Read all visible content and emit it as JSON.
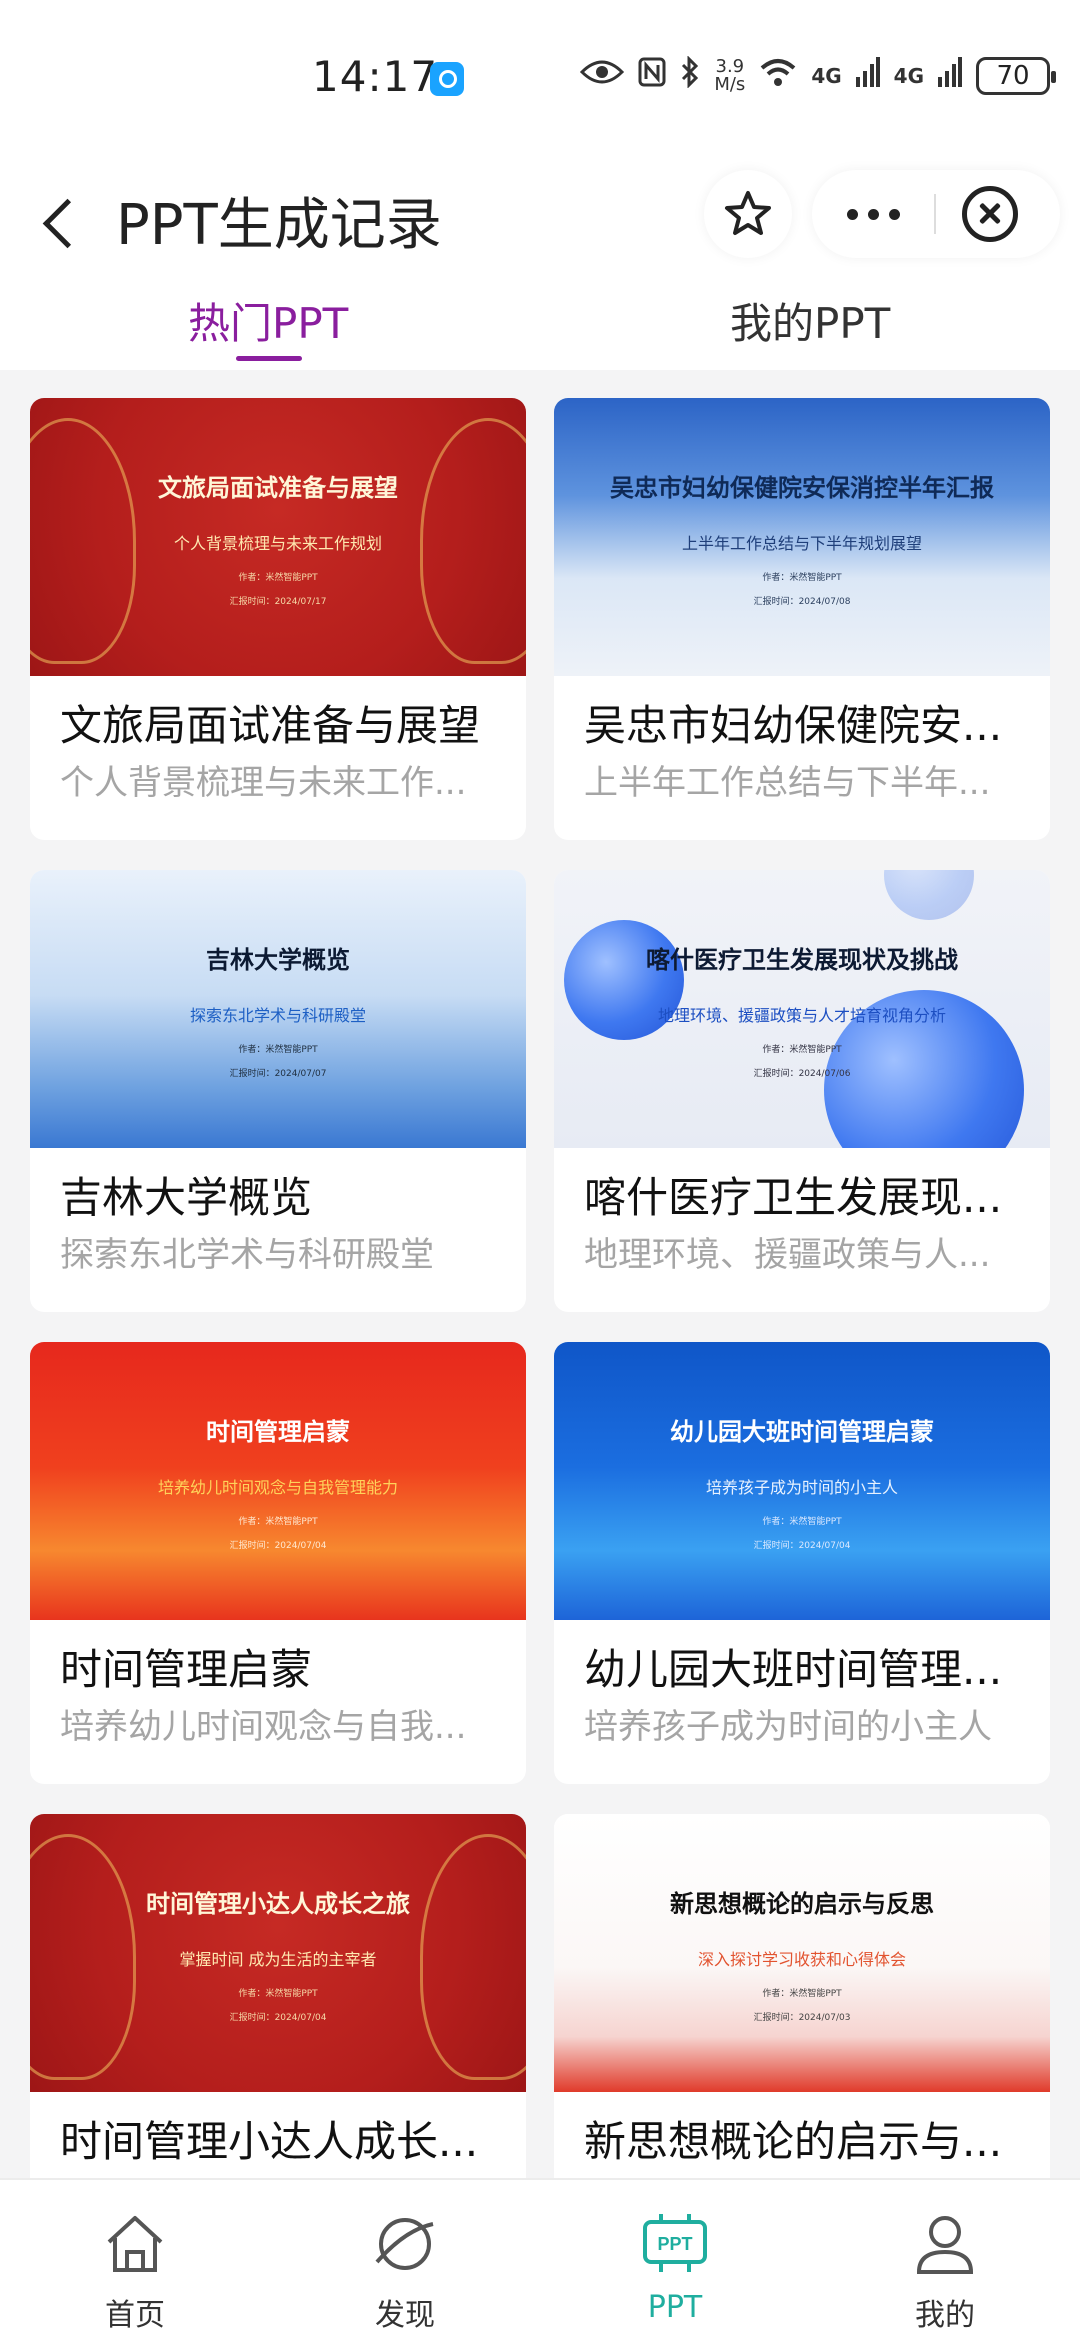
{
  "status_bar": {
    "time": "14:17",
    "speed_value": "3.9",
    "speed_unit": "M/s",
    "net1": "4G",
    "net2": "4G",
    "battery": "70"
  },
  "header": {
    "title": "PPT生成记录",
    "tabs": [
      {
        "label": "热门PPT",
        "active": true
      },
      {
        "label": "我的PPT",
        "active": false
      }
    ]
  },
  "cards": [
    {
      "title": "文旅局面试准备与展望",
      "subtitle": "个人背景梳理与未来工作...",
      "thumb": {
        "title": "文旅局面试准备与展望",
        "subtitle": "个人背景梳理与未来工作规划",
        "author": "作者：米然智能PPT",
        "date": "汇报时间：2024/07/17"
      }
    },
    {
      "title": "吴忠市妇幼保健院安...",
      "subtitle": "上半年工作总结与下半年...",
      "thumb": {
        "title": "吴忠市妇幼保健院安保消控半年汇报",
        "subtitle": "上半年工作总结与下半年规划展望",
        "author": "作者：米然智能PPT",
        "date": "汇报时间：2024/07/08"
      }
    },
    {
      "title": "吉林大学概览",
      "subtitle": "探索东北学术与科研殿堂",
      "thumb": {
        "title": "吉林大学概览",
        "subtitle": "探索东北学术与科研殿堂",
        "author": "作者：米然智能PPT",
        "date": "汇报时间：2024/07/07"
      }
    },
    {
      "title": "喀什医疗卫生发展现...",
      "subtitle": "地理环境、援疆政策与人...",
      "thumb": {
        "title": "喀什医疗卫生发展现状及挑战",
        "subtitle": "地理环境、援疆政策与人才培育视角分析",
        "author": "作者：米然智能PPT",
        "date": "汇报时间：2024/07/06"
      }
    },
    {
      "title": "时间管理启蒙",
      "subtitle": "培养幼儿时间观念与自我...",
      "thumb": {
        "title": "时间管理启蒙",
        "subtitle": "培养幼儿时间观念与自我管理能力",
        "author": "作者：米然智能PPT",
        "date": "汇报时间：2024/07/04"
      }
    },
    {
      "title": "幼儿园大班时间管理...",
      "subtitle": "培养孩子成为时间的小主人",
      "thumb": {
        "title": "幼儿园大班时间管理启蒙",
        "subtitle": "培养孩子成为时间的小主人",
        "author": "作者：米然智能PPT",
        "date": "汇报时间：2024/07/04"
      }
    },
    {
      "title": "时间管理小达人成长...",
      "subtitle": "",
      "thumb": {
        "title": "时间管理小达人成长之旅",
        "subtitle": "掌握时间 成为生活的主宰者",
        "author": "作者：米然智能PPT",
        "date": "汇报时间：2024/07/04"
      }
    },
    {
      "title": "新思想概论的启示与...",
      "subtitle": "",
      "thumb": {
        "title": "新思想概论的启示与反思",
        "subtitle": "深入探讨学习收获和心得体会",
        "author": "作者：米然智能PPT",
        "date": "汇报时间：2024/07/03"
      }
    }
  ],
  "bottom_nav": [
    {
      "label": "首页",
      "icon": "home-icon"
    },
    {
      "label": "发现",
      "icon": "discover-icon"
    },
    {
      "label": "PPT",
      "icon": "ppt-icon",
      "active": true
    },
    {
      "label": "我的",
      "icon": "profile-icon"
    }
  ],
  "colors": {
    "accent_purple": "#8a1e9e",
    "nav_active": "#1fae9f"
  }
}
